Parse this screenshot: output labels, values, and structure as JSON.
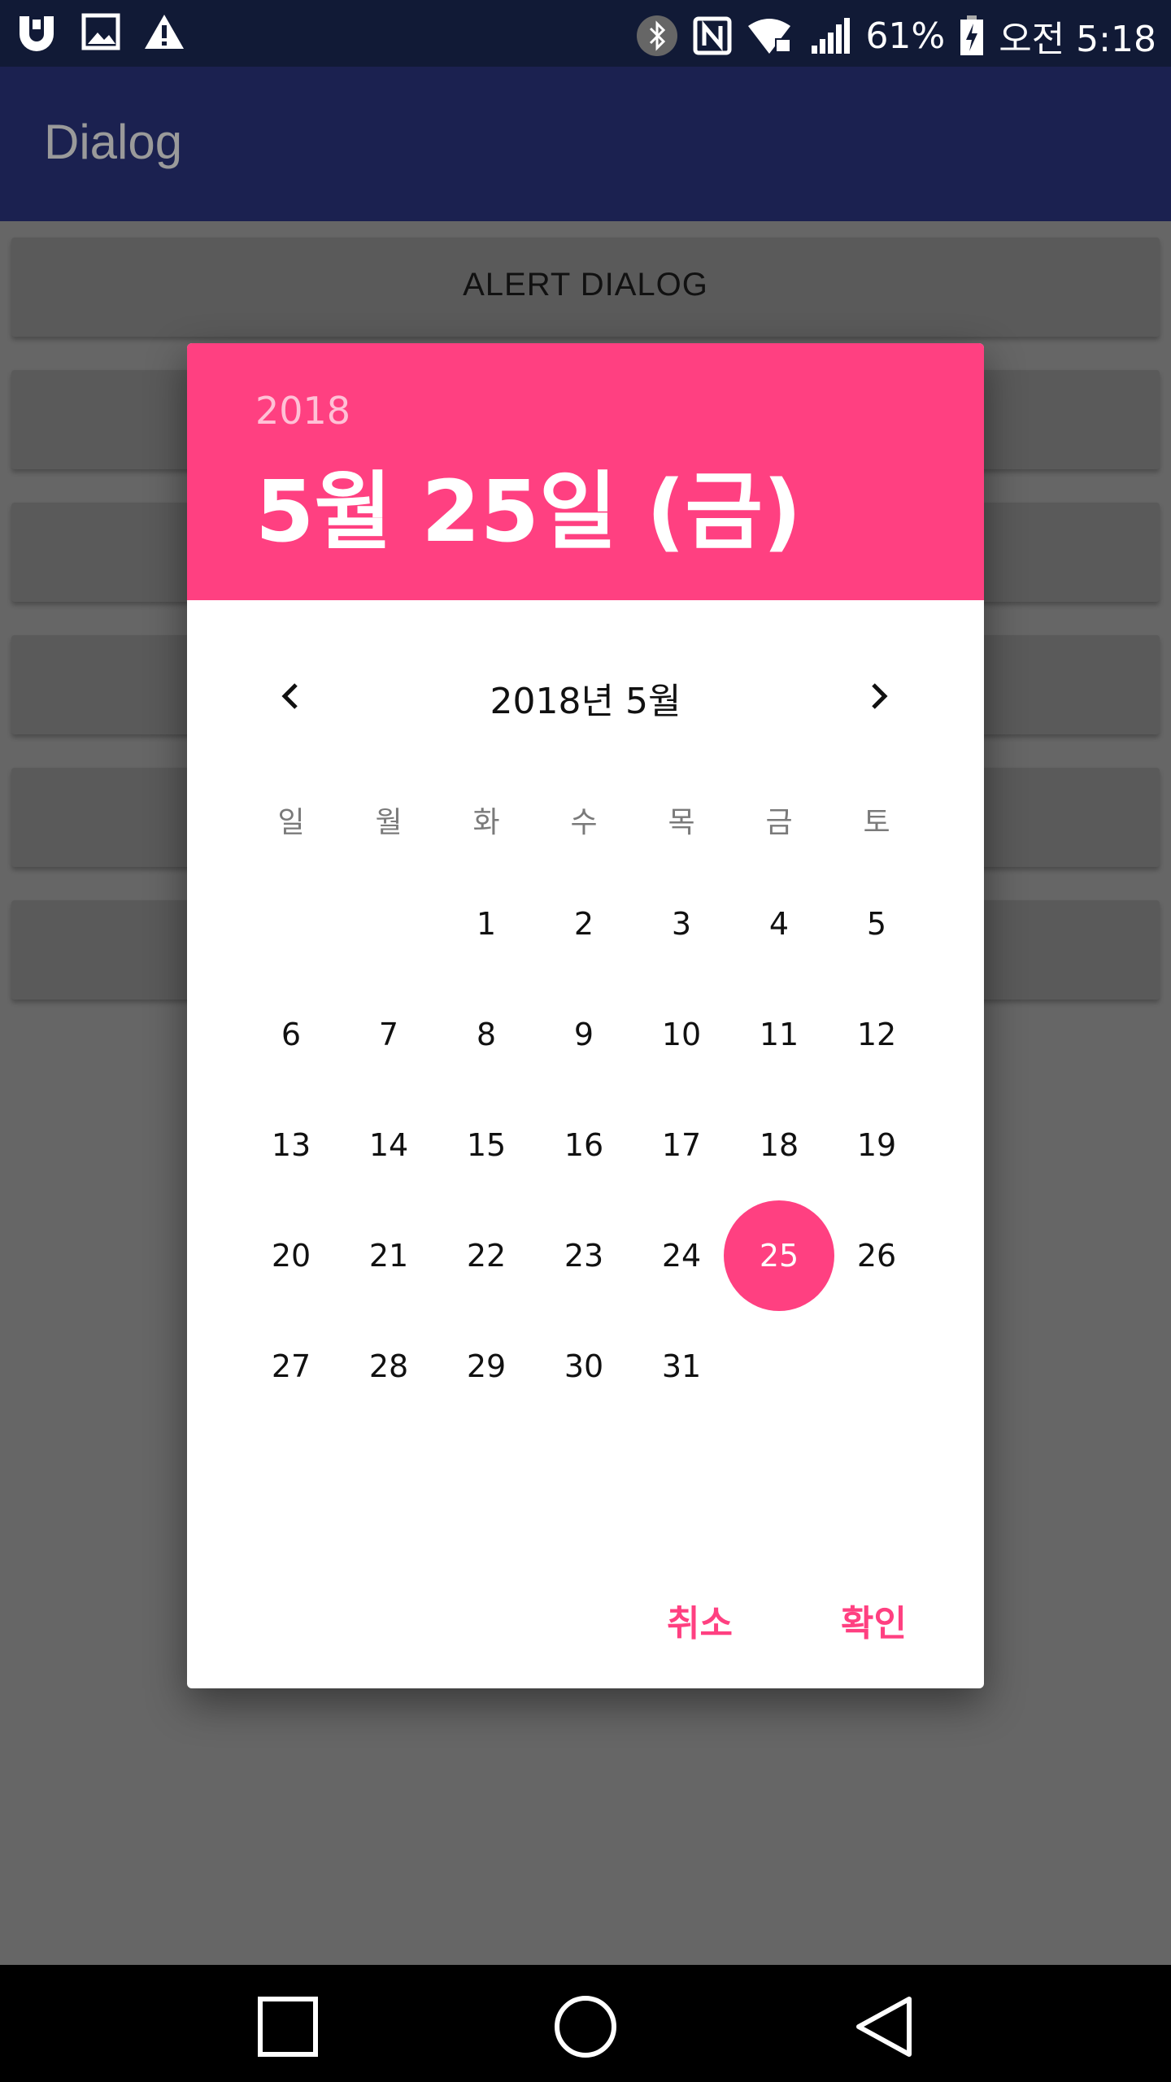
{
  "status_bar": {
    "battery": "61%",
    "clock": "오전 5:18"
  },
  "app": {
    "title": "Dialog"
  },
  "background_buttons": [
    "ALERT DIALOG",
    "",
    "",
    "",
    "",
    ""
  ],
  "date_picker": {
    "header_year": "2018",
    "header_date": "5월 25일 (금)",
    "month_title": "2018년 5월",
    "weekdays": [
      "일",
      "월",
      "화",
      "수",
      "목",
      "금",
      "토"
    ],
    "first_weekday_index": 2,
    "days": [
      "1",
      "2",
      "3",
      "4",
      "5",
      "6",
      "7",
      "8",
      "9",
      "10",
      "11",
      "12",
      "13",
      "14",
      "15",
      "16",
      "17",
      "18",
      "19",
      "20",
      "21",
      "22",
      "23",
      "24",
      "25",
      "26",
      "27",
      "28",
      "29",
      "30",
      "31"
    ],
    "selected_day": "25",
    "cancel_label": "취소",
    "ok_label": "확인",
    "accent_color": "#ff4081"
  },
  "icons": {
    "prev": "chevron-left-icon",
    "next": "chevron-right-icon",
    "nav_recent": "square-icon",
    "nav_home": "circle-icon",
    "nav_back": "triangle-back-icon"
  }
}
